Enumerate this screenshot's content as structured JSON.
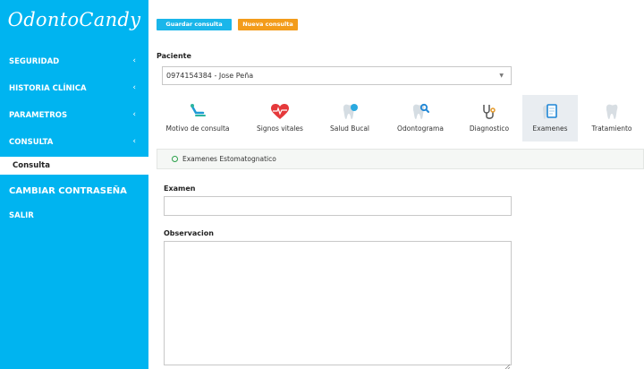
{
  "app": {
    "logo": "OdontoCandy"
  },
  "sidebar": {
    "items": [
      {
        "label": "SEGURIDAD",
        "chevron": "‹"
      },
      {
        "label": "HISTORIA CLÍNICA",
        "chevron": "‹"
      },
      {
        "label": "PARAMETROS",
        "chevron": "‹"
      },
      {
        "label": "CONSULTA",
        "chevron": "‹"
      }
    ],
    "active_sub": "Consulta",
    "change_password": "CAMBIAR CONTRASEÑA",
    "logout": "SALIR"
  },
  "toolbar": {
    "save_label": "Guardar consulta",
    "new_label": "Nueva consulta"
  },
  "patient": {
    "label": "Paciente",
    "selected": "0974154384 - Jose Peña"
  },
  "tabs": [
    {
      "label": "Motivo de consulta",
      "icon": "dental-chair-icon"
    },
    {
      "label": "Signos vitales",
      "icon": "heartbeat-icon"
    },
    {
      "label": "Salud Bucal",
      "icon": "tooth-shield-icon"
    },
    {
      "label": "Odontograma",
      "icon": "tooth-search-icon"
    },
    {
      "label": "Diagnostico",
      "icon": "stethoscope-icon"
    },
    {
      "label": "Examenes",
      "icon": "tooth-clipboard-icon"
    },
    {
      "label": "Tratamiento",
      "icon": "tooth-icon"
    }
  ],
  "active_tab": "Examenes",
  "section": {
    "title": "Examenes Estomatognatico"
  },
  "form": {
    "examen_label": "Examen",
    "examen_value": "",
    "observacion_label": "Observacion",
    "observacion_value": ""
  },
  "colors": {
    "sidebar": "#00b4f0",
    "save_button": "#1ab6ea",
    "new_button": "#f39c1b",
    "ring": "#2aa04a"
  }
}
